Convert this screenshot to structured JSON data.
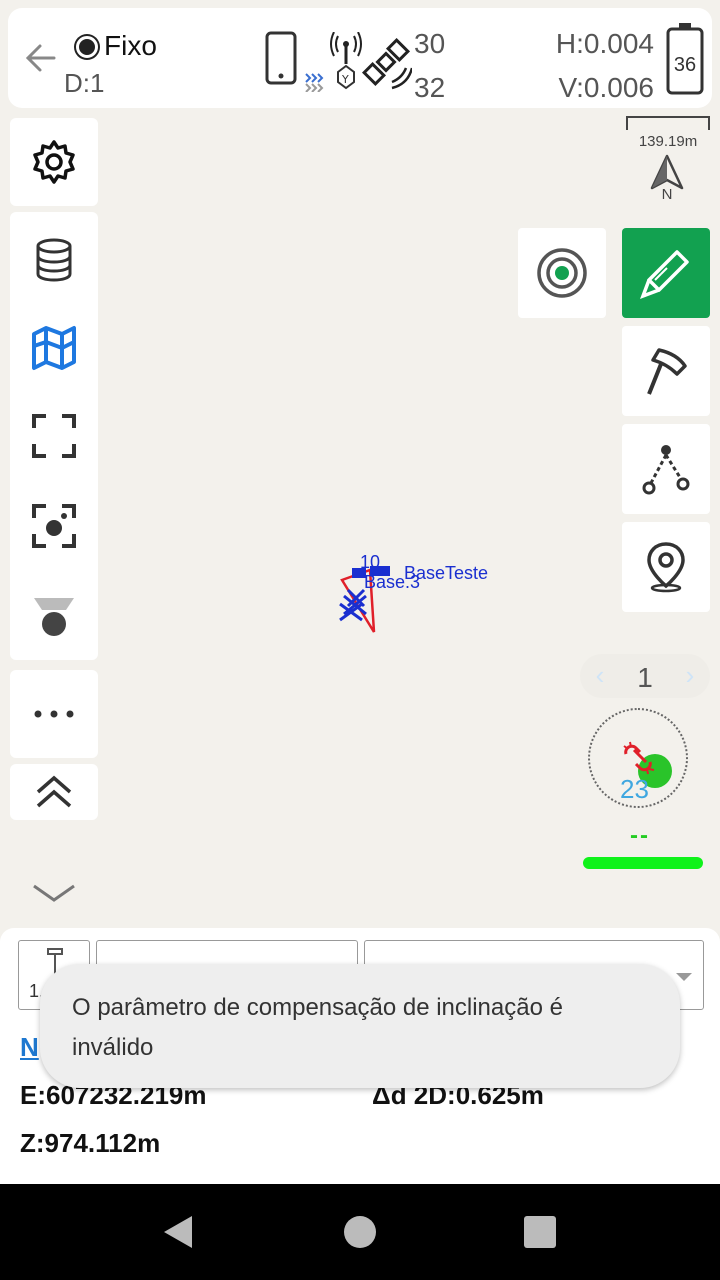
{
  "status": {
    "fix_label": "Fixo",
    "diff_label": "D:1",
    "sat_count_top": "30",
    "sat_count_bottom": "32",
    "h_precision": "H:0.004",
    "v_precision": "V:0.006",
    "battery": "36"
  },
  "map": {
    "scale": "139.19m",
    "north": "N",
    "point_label_1": "10",
    "point_label_2": "BaseTeste",
    "point_label_3": "Base.3"
  },
  "pager": {
    "prev": "‹",
    "page": "1",
    "next": "›"
  },
  "compass": {
    "value": "23",
    "dashes": "--"
  },
  "panel": {
    "antenna_height": "1.8",
    "n_label": "N",
    "e_coord": "E:607232.219m",
    "z_coord": "Z:974.112m",
    "delta_2d": "Δd 2D:0.625m"
  },
  "toast": {
    "message": "O parâmetro de compensação de inclinação é inválido"
  },
  "colors": {
    "accent_green": "#12a150",
    "map_blue": "#1a2fd0",
    "map_red": "#e0202a",
    "link_blue": "#1e78d0"
  }
}
